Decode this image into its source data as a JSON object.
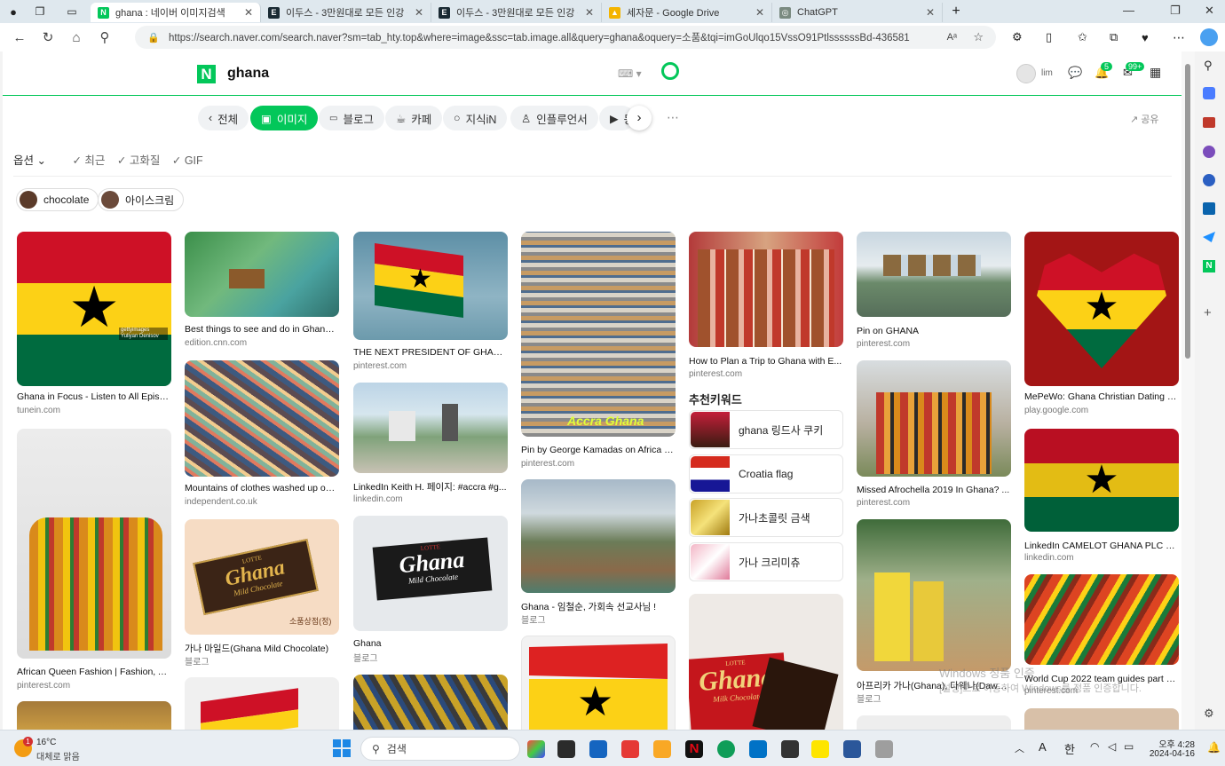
{
  "browser": {
    "tabs": [
      {
        "title": "ghana : 네이버 이미지검색",
        "active": true,
        "color": "#03c75a",
        "glyph": "N"
      },
      {
        "title": "이두스 - 3만원대로 모든 인강 구",
        "active": false,
        "color": "#1a2a33",
        "glyph": "E"
      },
      {
        "title": "이두스 - 3만원대로 모든 인강 구",
        "active": false,
        "color": "#1a2a33",
        "glyph": "E"
      },
      {
        "title": "세자문 - Google Drive",
        "active": false,
        "color": "#f4b400",
        "glyph": "▲"
      },
      {
        "title": "ChatGPT",
        "active": false,
        "color": "#7a8a80",
        "glyph": "◎"
      }
    ],
    "url": "https://search.naver.com/search.naver?sm=tab_hty.top&where=image&ssc=tab.image.all&query=ghana&oquery=소품&tqi=imGoUlqo15VssO91PtlssssssBd-436581"
  },
  "naver": {
    "query": "ghana",
    "user": "lim",
    "notif_count": "5",
    "mail_count": "99+",
    "tabs": [
      "전체",
      "이미지",
      "블로그",
      "카페",
      "지식iN",
      "인플루언서",
      "동"
    ],
    "share": "공유",
    "options": {
      "label": "옵션",
      "filters": [
        "최근",
        "고화질",
        "GIF"
      ]
    },
    "chips": [
      "chocolate",
      "아이스크림"
    ],
    "reco_title": "추천키워드",
    "reco": [
      "ghana 링드사 쿠키",
      "Croatia flag",
      "가나초콜릿 금색",
      "가나 크리미츄"
    ]
  },
  "results": [
    {
      "cap": "Ghana in Focus - Listen to All Episo...",
      "src": "tunein.com"
    },
    {
      "cap": "African Queen Fashion | Fashion, Afr...",
      "src": "pinterest.com"
    },
    {
      "cap": "Best things to see and do in Ghana ...",
      "src": "edition.cnn.com"
    },
    {
      "cap": "Mountains of clothes washed up on...",
      "src": "independent.co.uk"
    },
    {
      "cap": "가나 마일드(Ghana Mild Chocolate)",
      "src": "블로그"
    },
    {
      "cap": "THE NEXT PRESIDENT OF GHANA | ...",
      "src": "pinterest.com"
    },
    {
      "cap": "LinkedIn Keith H. 페이지: #accra #g...",
      "src": "linkedin.com"
    },
    {
      "cap": "Ghana",
      "src": "블로그"
    },
    {
      "cap": "Pin by George Kamadas on Africa | ...",
      "src": "pinterest.com"
    },
    {
      "cap": "Ghana - 임철순, 가회속 선교사님 !",
      "src": "블로그"
    },
    {
      "cap": "How to Plan a Trip to Ghana with E...",
      "src": "pinterest.com"
    },
    {
      "cap": "Pin on GHANA",
      "src": "pinterest.com"
    },
    {
      "cap": "Missed Afrochella 2019 In Ghana? ...",
      "src": "pinterest.com"
    },
    {
      "cap": "아프리카 가나(Ghana), 다웨나(Dawh...",
      "src": "블로그"
    },
    {
      "cap": "MePeWo: Ghana Christian Dating - ...",
      "src": "play.google.com"
    },
    {
      "cap": "LinkedIn CAMELOT GHANA PLC 페...",
      "src": "linkedin.com"
    },
    {
      "cap": "World Cup 2022 team guides part 2...",
      "src": "pinterest.com"
    }
  ],
  "image_text": {
    "getty": "gettyimages",
    "getty_credit": "Yuliyan Denisov",
    "accra": "Accra Ghana",
    "choco_lotte": "LOTTE",
    "choco_brand": "Ghana",
    "choco_mild": "Mild Chocolate",
    "choco_milk": "Milk Chocolate",
    "choco_blog_tag": "소품상점(정)"
  },
  "watermark": {
    "line1": "Windows 정품 인증",
    "line2": "[설정]으로 이동하여 Windows를 정품 인증합니다."
  },
  "taskbar": {
    "weather_temp": "16°C",
    "weather_desc": "대체로 맑음",
    "weather_badge": "1",
    "search": "검색",
    "time": "오후 4:28",
    "date": "2024-04-16",
    "lang_a": "A",
    "lang_han": "한"
  },
  "colors": {
    "naver_green": "#03c75a",
    "ghana_red": "#ce1126",
    "ghana_gold": "#fcd116",
    "ghana_green": "#006b3f"
  }
}
